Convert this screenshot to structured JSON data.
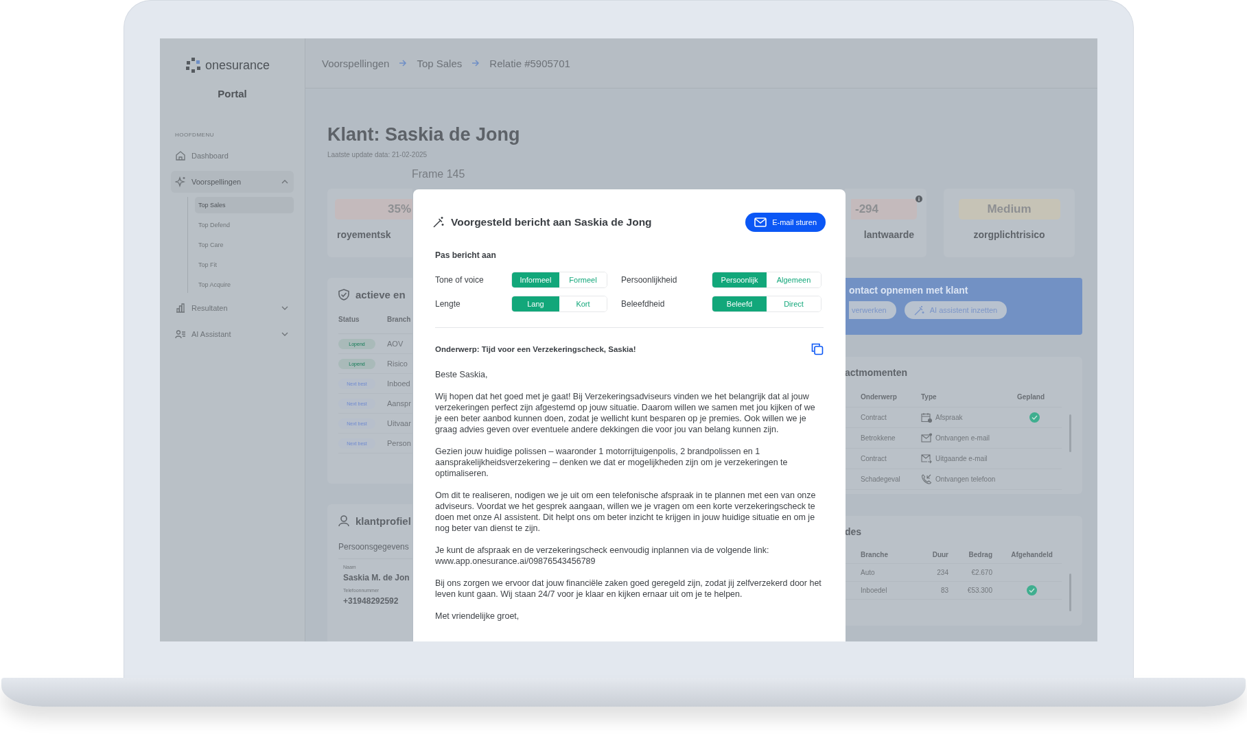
{
  "sidebar": {
    "logo": "onesurance",
    "subtitle": "Portal",
    "section": "HOOFDMENU",
    "items": [
      {
        "label": "Dashboard",
        "selected": false
      },
      {
        "label": "Voorspellingen",
        "selected": true,
        "expanded": true,
        "children": [
          {
            "label": "Top Sales",
            "selected": true
          },
          {
            "label": "Top Defend",
            "selected": false
          },
          {
            "label": "Top Care",
            "selected": false
          },
          {
            "label": "Top Fit",
            "selected": false
          },
          {
            "label": "Top Acquire",
            "selected": false
          }
        ]
      },
      {
        "label": "Resultaten",
        "selected": false,
        "expanded": false
      },
      {
        "label": "AI Assistant",
        "selected": false,
        "expanded": false
      }
    ]
  },
  "breadcrumb": [
    "Voorspellingen",
    "Top Sales",
    "Relatie #5905701"
  ],
  "title": "Klant: Saskia de Jong",
  "updated": "Laatste update data: 21-02-2025",
  "frame_label": "Frame 145",
  "kpi_cards": [
    {
      "value": "35%",
      "label": "royementsk",
      "color": "#c4babc"
    },
    {
      "value": "-294",
      "label": "lantwaarde",
      "color": "#c4babc",
      "info": true
    },
    {
      "value": "Medium",
      "label": "zorgplichtrisico",
      "color": "#c6c3b6",
      "info": false
    }
  ],
  "policies_panel": {
    "title": "actieve en",
    "columns": [
      "Status",
      "Branch"
    ],
    "rows": [
      {
        "status": "Lopend",
        "kind": "running",
        "branch": "AOV"
      },
      {
        "status": "Lopend",
        "kind": "running",
        "branch": "Risico"
      },
      {
        "status": "Next best",
        "kind": "advice",
        "branch": "Inboed"
      },
      {
        "status": "Next best",
        "kind": "advice",
        "branch": "Aanspr"
      },
      {
        "status": "Next best",
        "kind": "advice",
        "branch": "Uitvaar"
      },
      {
        "status": "Next best",
        "kind": "advice",
        "branch": "Person"
      }
    ]
  },
  "profile_panel": {
    "title": "klantprofiel",
    "section": "Persoonsgegevens",
    "fields": [
      {
        "label": "Naam",
        "value": "Saskia M. de Jon"
      },
      {
        "label": "Telefoonnummer",
        "value": "+31948292592"
      }
    ]
  },
  "contact_banner": {
    "title": "ontact opnemen met klant",
    "buttons": [
      "verwerken",
      "AI assistent inzetten"
    ]
  },
  "contacts_panel": {
    "title": "actmomenten",
    "columns": [
      "Onderwerp",
      "Type",
      "Gepland"
    ],
    "rows": [
      {
        "subject": "Contract",
        "kind": "appointment",
        "type": "Afspraak",
        "planned": true
      },
      {
        "subject": "Betrokkene",
        "kind": "mail_in",
        "type": "Ontvangen e-mail",
        "planned": false
      },
      {
        "subject": "Contract",
        "kind": "mail_out",
        "type": "Uitgaande e-mail",
        "planned": false
      },
      {
        "subject": "Schadegeval",
        "kind": "call_in",
        "type": "Ontvangen telefoon",
        "planned": false
      }
    ]
  },
  "claims_panel": {
    "title": "des",
    "columns": [
      "Branche",
      "Duur",
      "Bedrag",
      "Afgehandeld"
    ],
    "rows": [
      {
        "branch": "Auto",
        "duration": "234",
        "amount": "€2.670",
        "handled": false
      },
      {
        "branch": "Inboedel",
        "duration": "83",
        "amount": "€53.300",
        "handled": true
      }
    ]
  },
  "modal": {
    "title": "Voorgesteld bericht aan Saskia de Jong",
    "send_button": "E-mail sturen",
    "section": "Pas bericht aan",
    "options": [
      {
        "label": "Tone of voice",
        "choices": [
          {
            "label": "Informeel",
            "selected": true
          },
          {
            "label": "Formeel",
            "selected": false
          }
        ]
      },
      {
        "label": "Persoonlijkheid",
        "choices": [
          {
            "label": "Persoonlijk",
            "selected": true
          },
          {
            "label": "Algemeen",
            "selected": false
          }
        ]
      },
      {
        "label": "Lengte",
        "choices": [
          {
            "label": "Lang",
            "selected": true
          },
          {
            "label": "Kort",
            "selected": false
          }
        ]
      },
      {
        "label": "Beleefdheid",
        "choices": [
          {
            "label": "Beleefd",
            "selected": true
          },
          {
            "label": "Direct",
            "selected": false
          }
        ]
      }
    ],
    "subject": "Onderwerp: Tijd voor een Verzekeringscheck, Saskia!",
    "body": [
      "Beste Saskia,",
      "Wij hopen dat het goed met je gaat! Bij Verzekeringsadviseurs vinden we het belangrijk dat al jouw verzekeringen perfect zijn afgestemd op jouw situatie. Daarom willen we samen met jou kijken of we je een beter aanbod kunnen doen, zodat je wellicht kunt besparen op je premies. Ook willen we je graag advies geven over eventuele andere dekkingen die voor jou van belang kunnen zijn.",
      "Gezien jouw huidige polissen – waaronder 1 motorrijtuigenpolis, 2 brandpolissen en 1 aansprakelijkheidsverzekering – denken we dat er mogelijkheden zijn om je verzekeringen te optimaliseren.",
      "Om dit te realiseren, nodigen we je uit om een telefonische afspraak in te plannen met een van onze adviseurs. Voordat we het gesprek aangaan, willen we je vragen om een korte verzekeringscheck te doen met onze AI assistent. Dit helpt ons om beter inzicht te krijgen in jouw huidige situatie en om je nog beter van dienst te zijn.",
      "Je kunt de afspraak en de verzekeringscheck eenvoudig inplannen via de volgende link: www.app.onesurance.ai/09876543456789",
      "Bij ons zorgen we ervoor dat jouw financiële zaken goed geregeld zijn, zodat jij zelfverzekerd door het leven kunt gaan. Wij staan 24/7 voor je klaar en kijken ernaar uit om je te helpen.",
      "Met vriendelijke groet,"
    ]
  }
}
